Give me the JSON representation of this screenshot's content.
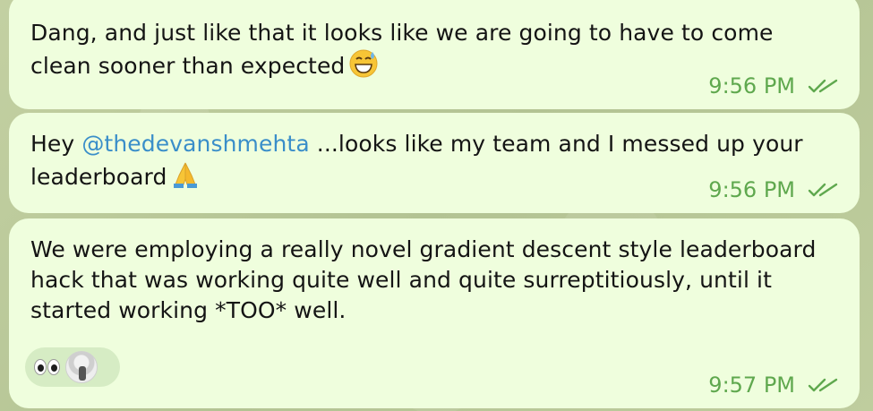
{
  "messages": [
    {
      "text": "Dang, and just like that it looks like we are going to have to come clean sooner than expected",
      "emoji": "grinning-face-with-sweat",
      "time": "9:56 PM",
      "status": "read"
    },
    {
      "prefix": "Hey ",
      "mention": "@thedevanshmehta",
      "text": "  ...looks like my team and I messed up your leaderboard",
      "emoji": "folded-hands",
      "time": "9:56 PM",
      "status": "read"
    },
    {
      "text": "We were employing a really novel gradient descent style leaderboard hack that was working quite well and quite surreptitiously, until it started working *TOO* well.",
      "time": "9:57 PM",
      "status": "read",
      "reactions": [
        {
          "emoji": "eyes"
        },
        {
          "type": "user-avatar"
        }
      ]
    }
  ],
  "colors": {
    "bubble": "#effedd",
    "time": "#5fa84e",
    "mention": "#3a8ec9",
    "wallpaper": "#b9c89a"
  }
}
